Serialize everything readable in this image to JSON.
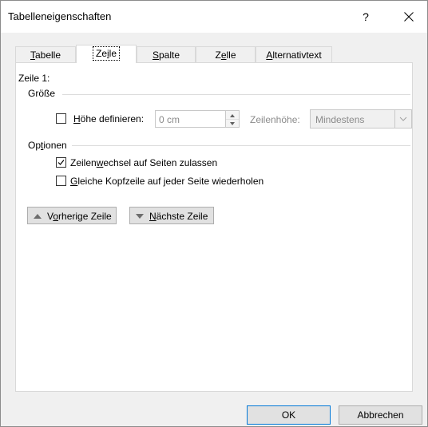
{
  "window": {
    "title": "Tabelleneigenschaften",
    "help_label": "?"
  },
  "tabs": [
    {
      "label": "Tabelle",
      "accel": "T"
    },
    {
      "label": "Zeile",
      "accel": "i"
    },
    {
      "label": "Spalte",
      "accel": "S"
    },
    {
      "label": "Zelle",
      "accel": "e"
    },
    {
      "label": "Alternativtext",
      "accel": "A"
    }
  ],
  "active_tab": "Zeile",
  "row_panel": {
    "row_heading": "Zeile 1:",
    "size_group": "Größe",
    "define_height": {
      "label": "Höhe definieren:",
      "checked": false,
      "value": "0 cm"
    },
    "row_height_label": "Zeilenhöhe:",
    "row_height_mode": "Mindestens",
    "options_group": "Optionen",
    "allow_break": {
      "label": "Zeilenwechsel auf Seiten zulassen",
      "checked": true
    },
    "repeat_header": {
      "label": "Gleiche Kopfzeile auf jeder Seite wiederholen",
      "checked": false
    },
    "prev_row_button": "Vorherige Zeile",
    "next_row_button": "Nächste Zeile"
  },
  "footer": {
    "ok_label": "OK",
    "cancel_label": "Abbrechen"
  },
  "colors": {
    "dialog_bg": "#f0f0f0",
    "panel_bg": "#ffffff",
    "focus_border": "#0078d7",
    "disabled_text": "#8a8a8a"
  },
  "icons": [
    "close-icon",
    "checkmark-icon",
    "spin-up-icon",
    "spin-down-icon",
    "chevron-down-icon",
    "triangle-up-icon",
    "triangle-down-icon"
  ]
}
